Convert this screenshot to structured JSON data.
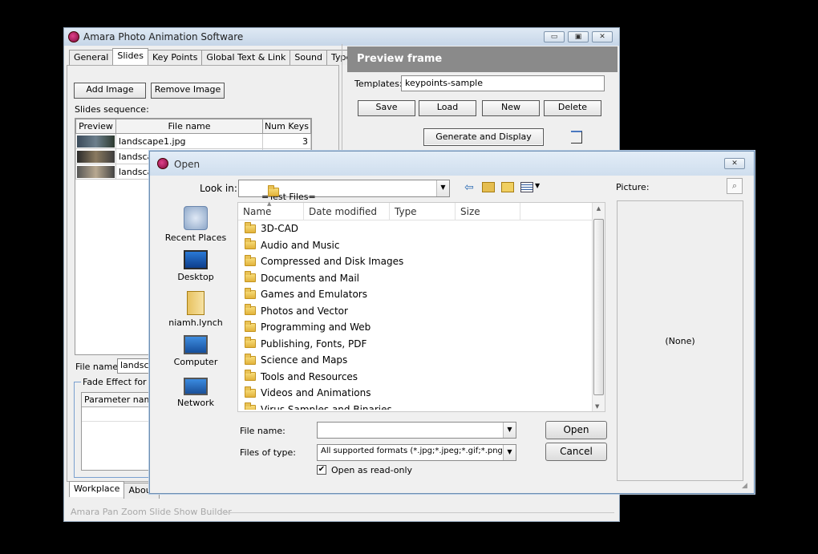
{
  "main_window": {
    "title": "Amara Photo Animation Software",
    "caption_buttons": [
      "▭",
      "▣",
      "✕"
    ],
    "tabs": [
      "General",
      "Slides",
      "Key Points",
      "Global Text & Link",
      "Sound",
      "Type"
    ],
    "add_image_label": "Add Image",
    "remove_image_label": "Remove Image",
    "slides_sequence_label": "Slides sequence:",
    "table_headers": [
      "Preview",
      "File name",
      "Num Keys"
    ],
    "slides": [
      {
        "file": "landscape1.jpg",
        "keys": "3"
      },
      {
        "file": "landsca",
        "keys": ""
      },
      {
        "file": "landsca",
        "keys": ""
      }
    ],
    "file_name_label": "File name:",
    "file_name_value": "landsca",
    "fade_label": "Fade Effect for s",
    "param_header": "Parameter name",
    "bottom_tabs": [
      "Workplace",
      "About"
    ],
    "footer": "Amara Pan Zoom Slide Show Builder",
    "preview_frame_title": "Preview frame",
    "templates_label": "Templates:",
    "templates_value": "keypoints-sample",
    "save_label": "Save",
    "load_label": "Load",
    "new_label": "New",
    "delete_label": "Delete",
    "generate_label": "Generate and Display"
  },
  "open_dialog": {
    "title": "Open",
    "close_glyph": "✕",
    "look_in_label": "Look in:",
    "look_in_value": "=Test Files=",
    "picture_label": "Picture:",
    "picture_none": "(None)",
    "nav_items": [
      "Recent Places",
      "Desktop",
      "niamh.lynch",
      "Computer",
      "Network"
    ],
    "columns": [
      "Name",
      "Date modified",
      "Type",
      "Size"
    ],
    "folders": [
      "3D-CAD",
      "Audio and Music",
      "Compressed and Disk Images",
      "Documents and Mail",
      "Games and Emulators",
      "Photos and Vector",
      "Programming and Web",
      "Publishing, Fonts, PDF",
      "Science and Maps",
      "Tools and Resources",
      "Videos and Animations",
      "Virus Samples and Binaries"
    ],
    "file_name_label": "File name:",
    "file_name_value": "",
    "files_of_type_label": "Files of type:",
    "files_of_type_value": "All supported formats (*.jpg;*.jpeg;*.gif;*.png;*.bm",
    "read_only_label": "Open as read-only",
    "read_only_checked": true,
    "open_label": "Open",
    "cancel_label": "Cancel"
  }
}
